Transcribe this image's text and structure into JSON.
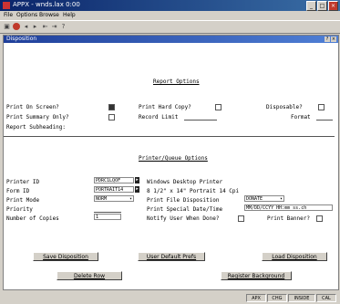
{
  "window": {
    "title": "APPX - wnds.lax 0:00"
  },
  "menu": [
    "File",
    "Options",
    "Browse",
    "Help"
  ],
  "panel": {
    "title": "Disposition"
  },
  "report_options": {
    "heading": "Report Options",
    "print_on_screen": "Print On Screen?",
    "print_hard_copy": "Print Hard Copy?",
    "disposable": "Disposable?",
    "print_summary_only": "Print Summary Only?",
    "record_limit": "Record Limit",
    "format": "Format",
    "report_subheading": "Report Subheading:"
  },
  "printer_options": {
    "heading": "Printer/Queue Options",
    "printer_id_label": "Printer ID",
    "printer_id_value": "PDRC1LQOF",
    "printer_id_desc": "Windows Desktop Printer",
    "form_id_label": "Form ID",
    "form_id_value": "PORTRAIT14",
    "form_id_desc": "8 1/2\" x 14\" Portrait 14 Cpi",
    "print_mode_label": "Print Mode",
    "print_mode_value": "NORM",
    "print_file_dispo_label": "Print File Disposition",
    "print_file_dispo_value": "DONATE",
    "priority_label": "Priority",
    "print_special_dt_label": "Print Special Date/Time",
    "print_special_dt_value": "MM/DD/CCYY HH:mm ss.ch",
    "copies_label": "Number of Copies",
    "copies_value": "1",
    "notify_label": "Notify User When Done?",
    "print_banner_label": "Print Banner?"
  },
  "buttons": {
    "save_disposition": "Save Disposition",
    "user_default_prefs": "User Default Prefs",
    "load_disposition": "Load Disposition",
    "delete_row": "Delete Row",
    "register_background": "Register Background"
  },
  "status": [
    "APX",
    "CHG",
    "INSIDE",
    "CAL"
  ]
}
